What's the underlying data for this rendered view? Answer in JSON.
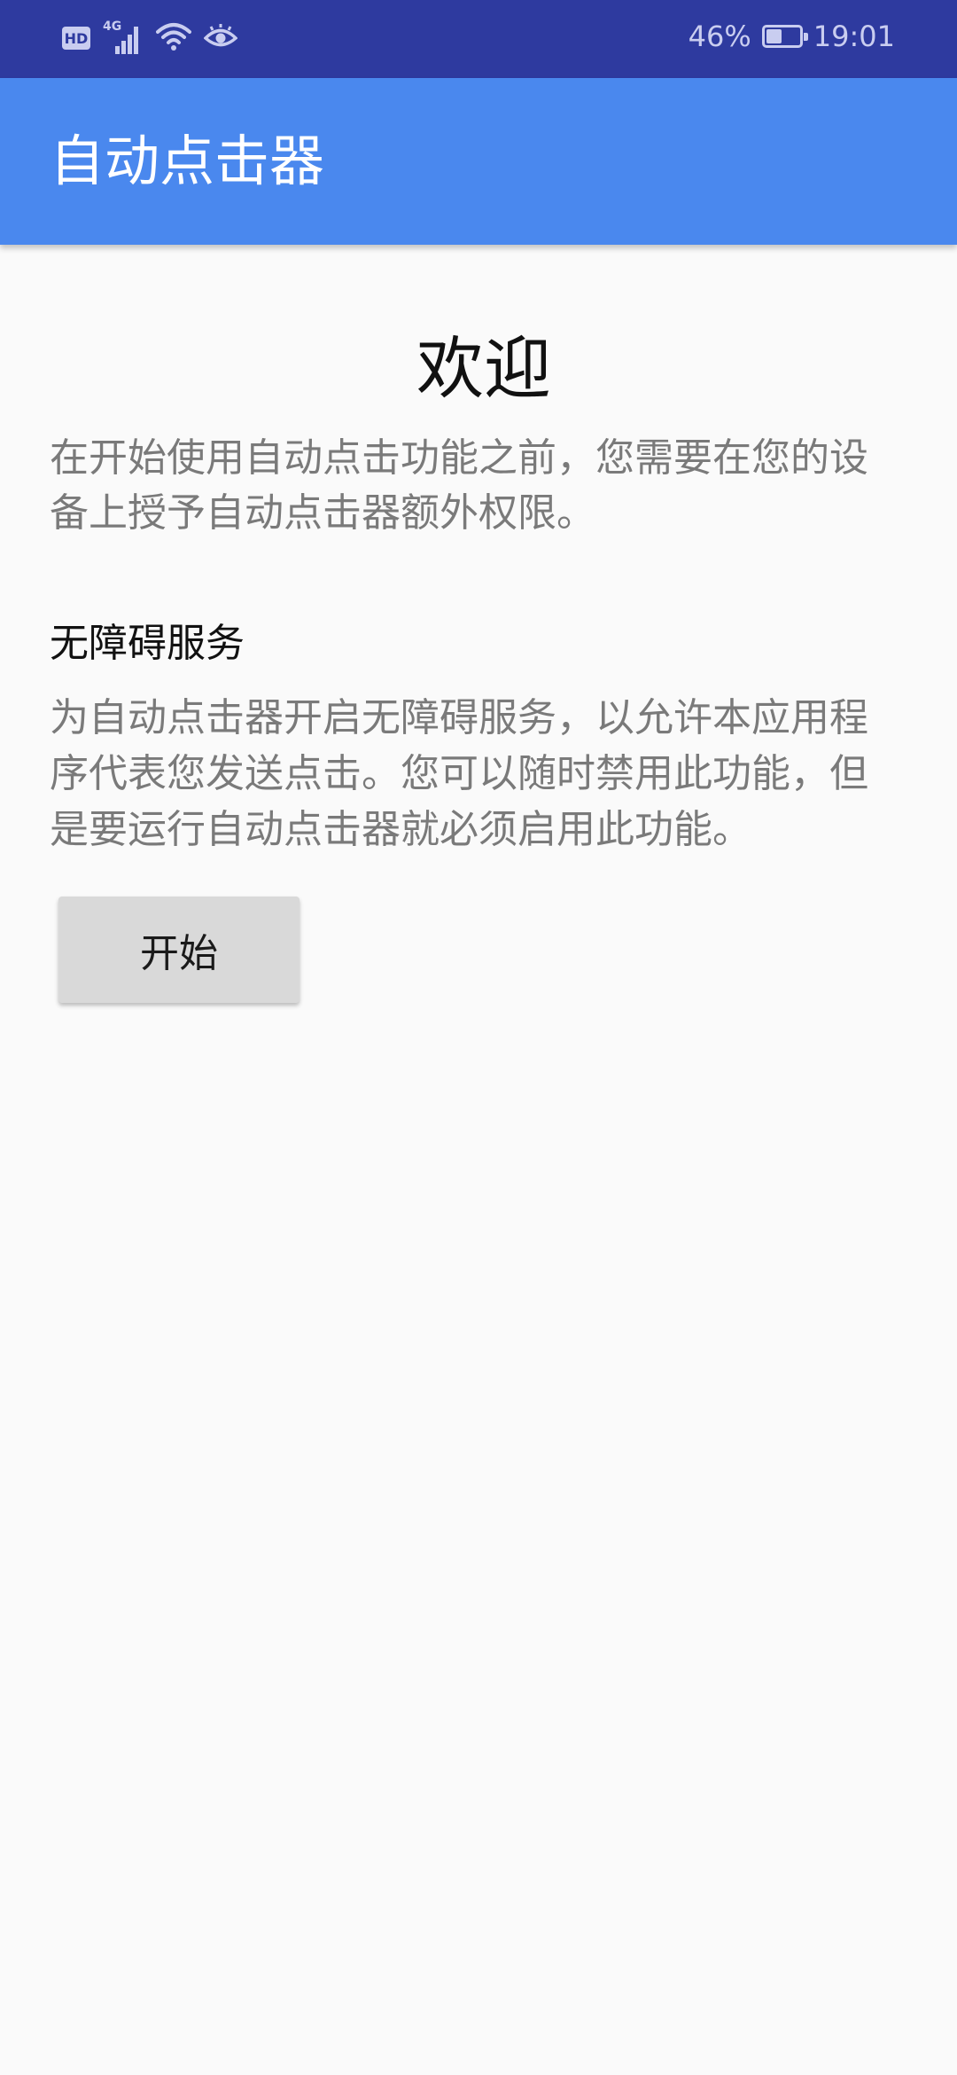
{
  "status_bar": {
    "hd_label": "HD",
    "network_label": "4G",
    "battery_percent": "46%",
    "battery_level": 0.46,
    "time": "19:01",
    "icons": [
      "hd-icon",
      "signal-icon",
      "wifi-icon",
      "eye-icon",
      "battery-icon"
    ]
  },
  "app_bar": {
    "title": "自动点击器",
    "background": "#4a88ee"
  },
  "main": {
    "welcome_title": "欢迎",
    "intro_text": "在开始使用自动点击功能之前，您需要在您的设备上授予自动点击器额外权限。",
    "section_title": "无障碍服务",
    "section_text": "为自动点击器开启无障碍服务，以允许本应用程序代表您发送点击。您可以随时禁用此功能，但是要运行自动点击器就必须启用此功能。",
    "start_button_label": "开始"
  },
  "colors": {
    "status_bar": "#2e3a9f",
    "app_bar": "#4a88ee",
    "background": "#fafafa",
    "secondary_text": "#7a7a7a",
    "button": "#d9d9d9"
  }
}
